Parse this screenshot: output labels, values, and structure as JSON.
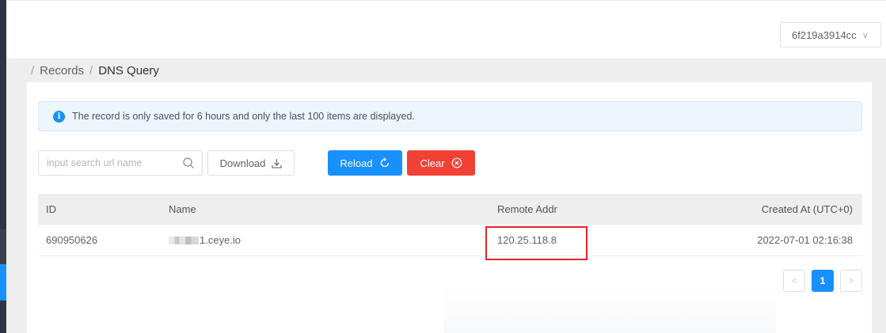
{
  "header": {
    "account_selector": "6f219a3914cc"
  },
  "breadcrumb": {
    "items": [
      "Records",
      "DNS Query"
    ]
  },
  "alert": {
    "message": "The record is only saved for 6 hours and only the last 100 items are displayed."
  },
  "toolbar": {
    "search_placeholder": "input search url name",
    "download_label": "Download",
    "reload_label": "Reload",
    "clear_label": "Clear"
  },
  "table": {
    "columns": [
      "ID",
      "Name",
      "Remote Addr",
      "Created At (UTC+0)"
    ],
    "rows": [
      {
        "id": "690950626",
        "name": "1.ceye.io",
        "remote_addr": "120.25.118.8",
        "created_at": "2022-07-01 02:16:38"
      }
    ]
  },
  "pagination": {
    "prev": "<",
    "current_page": "1",
    "next": ">"
  },
  "colors": {
    "primary": "#1890ff",
    "danger": "#f04134",
    "highlight": "#e5242b"
  },
  "icons": {
    "search": "search-icon",
    "download": "download-icon",
    "reload": "reload-icon",
    "clear": "clear-circle-icon",
    "info": "info-icon"
  }
}
